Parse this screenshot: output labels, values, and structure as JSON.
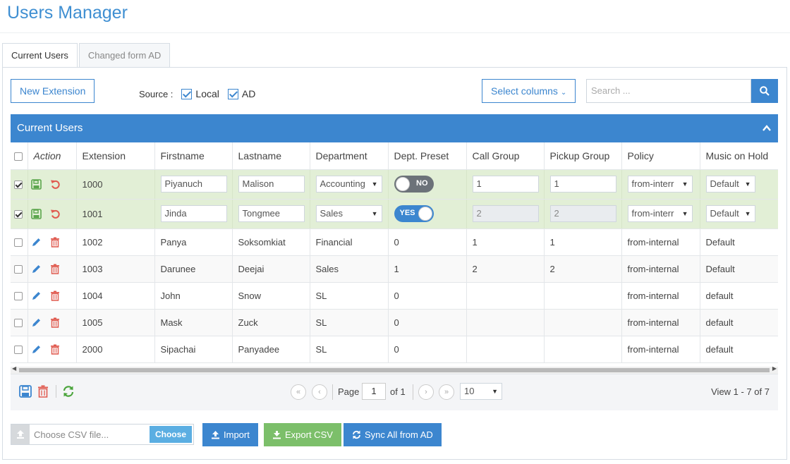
{
  "page_title": "Users Manager",
  "tabs": [
    {
      "label": "Current Users",
      "active": true
    },
    {
      "label": "Changed form AD",
      "active": false
    }
  ],
  "toolbar": {
    "new_extension_label": "New Extension",
    "source_label": "Source :",
    "source_local_label": "Local",
    "source_ad_label": "AD",
    "select_columns_label": "Select columns",
    "search_placeholder": "Search ..."
  },
  "grid": {
    "title": "Current Users",
    "columns": [
      "Action",
      "Extension",
      "Firstname",
      "Lastname",
      "Department",
      "Dept. Preset",
      "Call Group",
      "Pickup Group",
      "Policy",
      "Music on Hold"
    ],
    "edit_rows": [
      {
        "checked": true,
        "extension": "1000",
        "firstname": "Piyanuch",
        "lastname": "Malison",
        "department": "Accounting",
        "preset": "NO",
        "call_group": "1",
        "pickup_group": "1",
        "policy": "from-interr",
        "moh": "Default"
      },
      {
        "checked": true,
        "extension": "1001",
        "firstname": "Jinda",
        "lastname": "Tongmee",
        "department": "Sales",
        "preset": "YES",
        "call_group": "2",
        "pickup_group": "2",
        "policy": "from-interr",
        "moh": "Default"
      }
    ],
    "rows": [
      {
        "extension": "1002",
        "firstname": "Panya",
        "lastname": "Soksomkiat",
        "department": "Financial",
        "preset": "0",
        "call_group": "1",
        "pickup_group": "1",
        "policy": "from-internal",
        "moh": "Default"
      },
      {
        "extension": "1003",
        "firstname": "Darunee",
        "lastname": "Deejai",
        "department": "Sales",
        "preset": "1",
        "call_group": "2",
        "pickup_group": "2",
        "policy": "from-internal",
        "moh": "Default"
      },
      {
        "extension": "1004",
        "firstname": "John",
        "lastname": "Snow",
        "department": "SL",
        "preset": "0",
        "call_group": "",
        "pickup_group": "",
        "policy": "from-internal",
        "moh": "default"
      },
      {
        "extension": "1005",
        "firstname": "Mask",
        "lastname": "Zuck",
        "department": "SL",
        "preset": "0",
        "call_group": "",
        "pickup_group": "",
        "policy": "from-internal",
        "moh": "default"
      },
      {
        "extension": "2000",
        "firstname": "Sipachai",
        "lastname": "Panyadee",
        "department": "SL",
        "preset": "0",
        "call_group": "",
        "pickup_group": "",
        "policy": "from-internal",
        "moh": "default"
      }
    ]
  },
  "pager": {
    "page_label": "Page",
    "page_value": "1",
    "of_label": "of 1",
    "page_size": "10",
    "view_label": "View 1 - 7 of 7"
  },
  "bottom": {
    "file_placeholder": "Choose CSV file...",
    "choose_label": "Choose",
    "import_label": "Import",
    "export_label": "Export CSV",
    "sync_label": "Sync All from AD"
  },
  "colors": {
    "accent": "#3c86cf",
    "edit_row": "#e2efd6",
    "export_button": "#7cbf6a",
    "delete_icon": "#e05a4f",
    "save_icon": "#5aa54b"
  },
  "icons": [
    "search-icon",
    "chevron-up-icon",
    "save-icon",
    "undo-icon",
    "edit-icon",
    "trash-icon",
    "refresh-icon",
    "upload-icon",
    "download-icon",
    "sync-icon"
  ]
}
